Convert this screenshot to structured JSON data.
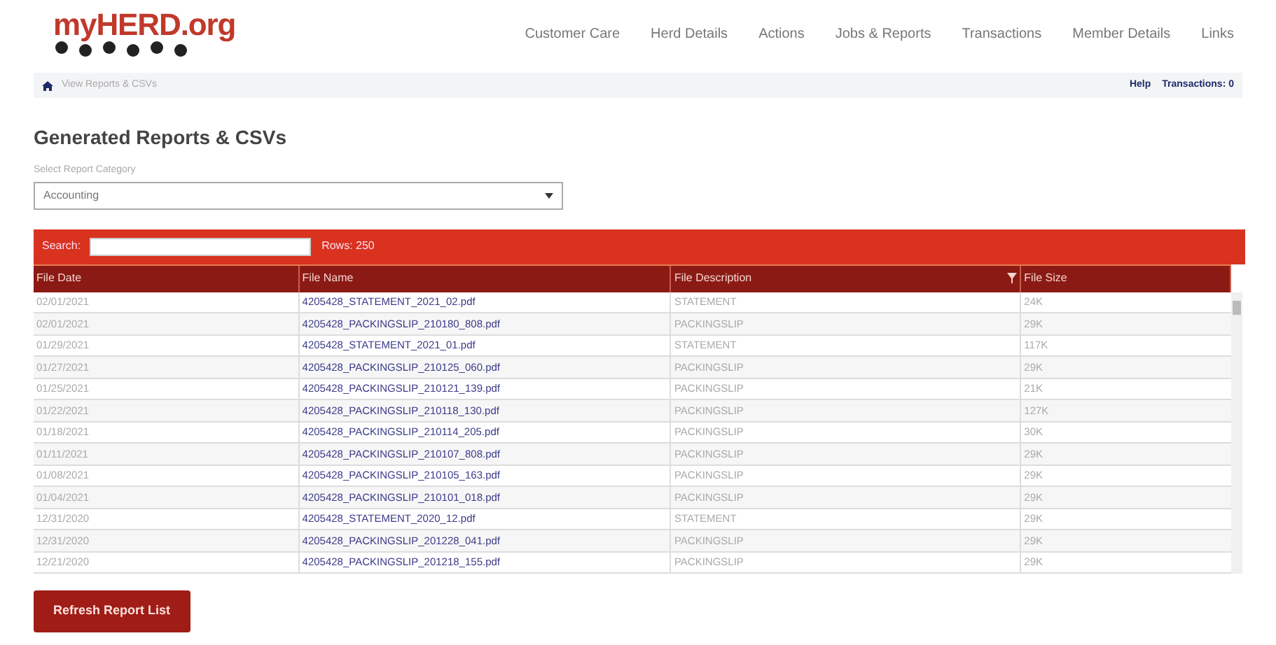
{
  "logo": {
    "text": "myHERD.org"
  },
  "nav": [
    "Customer Care",
    "Herd Details",
    "Actions",
    "Jobs & Reports",
    "Transactions",
    "Member Details",
    "Links"
  ],
  "breadcrumb": {
    "current": "View Reports & CSVs"
  },
  "top_links": [
    "Help",
    "Transactions: 0"
  ],
  "title": "Generated Reports & CSVs",
  "category": {
    "label": "Select Report Category",
    "value": "Accounting"
  },
  "toolbar": {
    "search_label": "Search:",
    "rows": "Rows: 250"
  },
  "table": {
    "columns": [
      {
        "label": "File Date",
        "filter": false
      },
      {
        "label": "File Name",
        "filter": false
      },
      {
        "label": "File Description",
        "filter": true
      },
      {
        "label": "File Size",
        "filter": false
      }
    ],
    "rows": [
      {
        "date": "02/01/2021",
        "name": "4205428_STATEMENT_2021_02.pdf",
        "description": "STATEMENT",
        "size": "24K"
      },
      {
        "date": "02/01/2021",
        "name": "4205428_PACKINGSLIP_210180_808.pdf",
        "description": "PACKINGSLIP",
        "size": "29K"
      },
      {
        "date": "01/29/2021",
        "name": "4205428_STATEMENT_2021_01.pdf",
        "description": "STATEMENT",
        "size": "117K"
      },
      {
        "date": "01/27/2021",
        "name": "4205428_PACKINGSLIP_210125_060.pdf",
        "description": "PACKINGSLIP",
        "size": "29K"
      },
      {
        "date": "01/25/2021",
        "name": "4205428_PACKINGSLIP_210121_139.pdf",
        "description": "PACKINGSLIP",
        "size": "21K"
      },
      {
        "date": "01/22/2021",
        "name": "4205428_PACKINGSLIP_210118_130.pdf",
        "description": "PACKINGSLIP",
        "size": "127K"
      },
      {
        "date": "01/18/2021",
        "name": "4205428_PACKINGSLIP_210114_205.pdf",
        "description": "PACKINGSLIP",
        "size": "30K"
      },
      {
        "date": "01/11/2021",
        "name": "4205428_PACKINGSLIP_210107_808.pdf",
        "description": "PACKINGSLIP",
        "size": "29K"
      },
      {
        "date": "01/08/2021",
        "name": "4205428_PACKINGSLIP_210105_163.pdf",
        "description": "PACKINGSLIP",
        "size": "29K"
      },
      {
        "date": "01/04/2021",
        "name": "4205428_PACKINGSLIP_210101_018.pdf",
        "description": "PACKINGSLIP",
        "size": "29K"
      },
      {
        "date": "12/31/2020",
        "name": "4205428_STATEMENT_2020_12.pdf",
        "description": "STATEMENT",
        "size": "29K"
      },
      {
        "date": "12/31/2020",
        "name": "4205428_PACKINGSLIP_201228_041.pdf",
        "description": "PACKINGSLIP",
        "size": "29K"
      },
      {
        "date": "12/21/2020",
        "name": "4205428_PACKINGSLIP_201218_155.pdf",
        "description": "PACKINGSLIP",
        "size": "29K"
      }
    ]
  },
  "refresh_button": "Refresh Report List"
}
